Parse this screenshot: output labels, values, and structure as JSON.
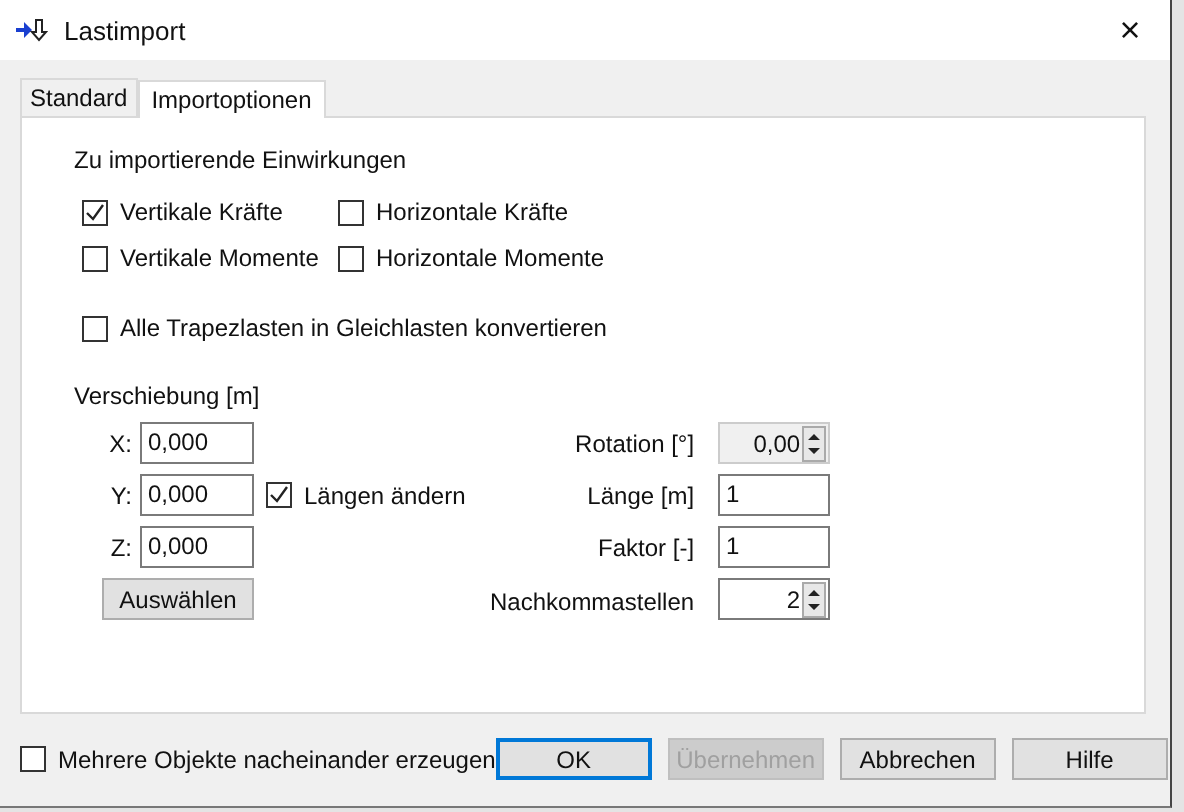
{
  "window": {
    "title": "Lastimport",
    "close": "×"
  },
  "tabs": [
    {
      "label": "Standard",
      "selected": false
    },
    {
      "label": "Importoptionen",
      "selected": true
    }
  ],
  "einwirkungen": {
    "heading": "Zu importierende Einwirkungen",
    "options": [
      {
        "label": "Vertikale Kräfte",
        "checked": true
      },
      {
        "label": "Horizontale Kräfte",
        "checked": false
      },
      {
        "label": "Vertikale Momente",
        "checked": false
      },
      {
        "label": "Horizontale Momente",
        "checked": false
      }
    ]
  },
  "trapez": {
    "label": "Alle Trapezlasten in Gleichlasten konvertieren",
    "checked": false
  },
  "verschiebung": {
    "heading": "Verschiebung [m]",
    "coords": [
      {
        "label": "X:",
        "value": "0,000"
      },
      {
        "label": "Y:",
        "value": "0,000"
      },
      {
        "label": "Z:",
        "value": "0,000"
      }
    ],
    "select_button": "Auswählen"
  },
  "laengen": {
    "label": "Längen ändern",
    "checked": true
  },
  "params": [
    {
      "kind": "spinner",
      "label": "Rotation [°]",
      "value": "0,00",
      "disabled": true
    },
    {
      "kind": "text",
      "label": "Länge [m]",
      "value": "1",
      "disabled": false
    },
    {
      "kind": "text",
      "label": "Faktor [-]",
      "value": "1",
      "disabled": false
    },
    {
      "kind": "spinner",
      "label": "Nachkommastellen",
      "value": "2",
      "disabled": false
    }
  ],
  "footer": {
    "multi": {
      "label": "Mehrere Objekte nacheinander erzeugen",
      "checked": false
    },
    "buttons": [
      {
        "label": "OK",
        "default": true,
        "disabled": false
      },
      {
        "label": "Übernehmen",
        "default": false,
        "disabled": true
      },
      {
        "label": "Abbrechen",
        "default": false,
        "disabled": false
      },
      {
        "label": "Hilfe",
        "default": false,
        "disabled": false
      }
    ]
  }
}
